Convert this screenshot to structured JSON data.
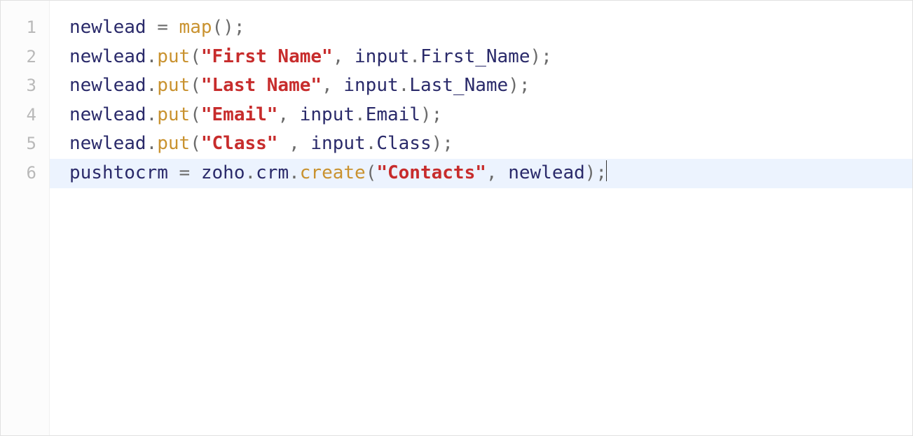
{
  "editor": {
    "active_line": 6,
    "lines": [
      {
        "number": "1",
        "tokens": [
          {
            "cls": "tok-ident",
            "t": "newlead"
          },
          {
            "cls": "tok-punct",
            "t": " = "
          },
          {
            "cls": "tok-func",
            "t": "map"
          },
          {
            "cls": "tok-punct",
            "t": "();"
          }
        ]
      },
      {
        "number": "2",
        "tokens": [
          {
            "cls": "tok-ident",
            "t": "newlead"
          },
          {
            "cls": "tok-punct",
            "t": "."
          },
          {
            "cls": "tok-func",
            "t": "put"
          },
          {
            "cls": "tok-punct",
            "t": "("
          },
          {
            "cls": "tok-str",
            "t": "\"First Name\""
          },
          {
            "cls": "tok-punct",
            "t": ", "
          },
          {
            "cls": "tok-ident",
            "t": "input"
          },
          {
            "cls": "tok-punct",
            "t": "."
          },
          {
            "cls": "tok-ident",
            "t": "First_Name"
          },
          {
            "cls": "tok-punct",
            "t": ");"
          }
        ]
      },
      {
        "number": "3",
        "tokens": [
          {
            "cls": "tok-ident",
            "t": "newlead"
          },
          {
            "cls": "tok-punct",
            "t": "."
          },
          {
            "cls": "tok-func",
            "t": "put"
          },
          {
            "cls": "tok-punct",
            "t": "("
          },
          {
            "cls": "tok-str",
            "t": "\"Last Name\""
          },
          {
            "cls": "tok-punct",
            "t": ", "
          },
          {
            "cls": "tok-ident",
            "t": "input"
          },
          {
            "cls": "tok-punct",
            "t": "."
          },
          {
            "cls": "tok-ident",
            "t": "Last_Name"
          },
          {
            "cls": "tok-punct",
            "t": ");"
          }
        ]
      },
      {
        "number": "4",
        "tokens": [
          {
            "cls": "tok-ident",
            "t": "newlead"
          },
          {
            "cls": "tok-punct",
            "t": "."
          },
          {
            "cls": "tok-func",
            "t": "put"
          },
          {
            "cls": "tok-punct",
            "t": "("
          },
          {
            "cls": "tok-str",
            "t": "\"Email\""
          },
          {
            "cls": "tok-punct",
            "t": ", "
          },
          {
            "cls": "tok-ident",
            "t": "input"
          },
          {
            "cls": "tok-punct",
            "t": "."
          },
          {
            "cls": "tok-ident",
            "t": "Email"
          },
          {
            "cls": "tok-punct",
            "t": ");"
          }
        ]
      },
      {
        "number": "5",
        "tokens": [
          {
            "cls": "tok-ident",
            "t": "newlead"
          },
          {
            "cls": "tok-punct",
            "t": "."
          },
          {
            "cls": "tok-func",
            "t": "put"
          },
          {
            "cls": "tok-punct",
            "t": "("
          },
          {
            "cls": "tok-str",
            "t": "\"Class\""
          },
          {
            "cls": "tok-punct",
            "t": " , "
          },
          {
            "cls": "tok-ident",
            "t": "input"
          },
          {
            "cls": "tok-punct",
            "t": "."
          },
          {
            "cls": "tok-ident",
            "t": "Class"
          },
          {
            "cls": "tok-punct",
            "t": ");"
          }
        ]
      },
      {
        "number": "6",
        "tokens": [
          {
            "cls": "tok-ident",
            "t": "pushtocrm"
          },
          {
            "cls": "tok-punct",
            "t": " = "
          },
          {
            "cls": "tok-ident",
            "t": "zoho"
          },
          {
            "cls": "tok-punct",
            "t": "."
          },
          {
            "cls": "tok-ident",
            "t": "crm"
          },
          {
            "cls": "tok-punct",
            "t": "."
          },
          {
            "cls": "tok-func",
            "t": "create"
          },
          {
            "cls": "tok-punct",
            "t": "("
          },
          {
            "cls": "tok-str",
            "t": "\"Contacts\""
          },
          {
            "cls": "tok-punct",
            "t": ", "
          },
          {
            "cls": "tok-ident",
            "t": "newlead"
          },
          {
            "cls": "tok-punct",
            "t": ");"
          }
        ]
      }
    ]
  }
}
